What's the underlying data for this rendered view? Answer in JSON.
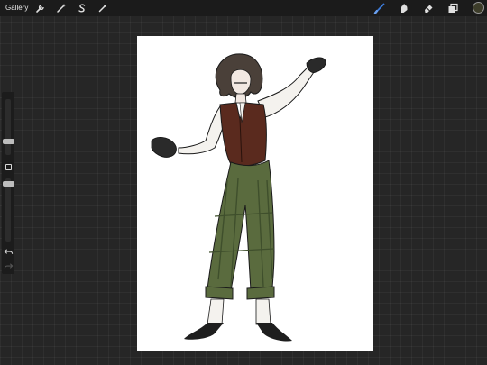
{
  "topbar": {
    "gallery_label": "Gallery",
    "left_tools": [
      "actions-wrench-icon",
      "adjustments-wand-icon",
      "selection-s-icon",
      "transform-arrow-icon"
    ],
    "right_tools": [
      "brush-icon",
      "smudge-icon",
      "eraser-icon",
      "layers-icon"
    ],
    "active_tool": "brush-icon",
    "active_color": "#3d3d2a",
    "accent_color": "#3d7bd9"
  },
  "sidebar": {
    "size_slider_value": 0.35,
    "opacity_slider_value": 0.95
  },
  "canvas": {
    "subject": "illustration"
  }
}
